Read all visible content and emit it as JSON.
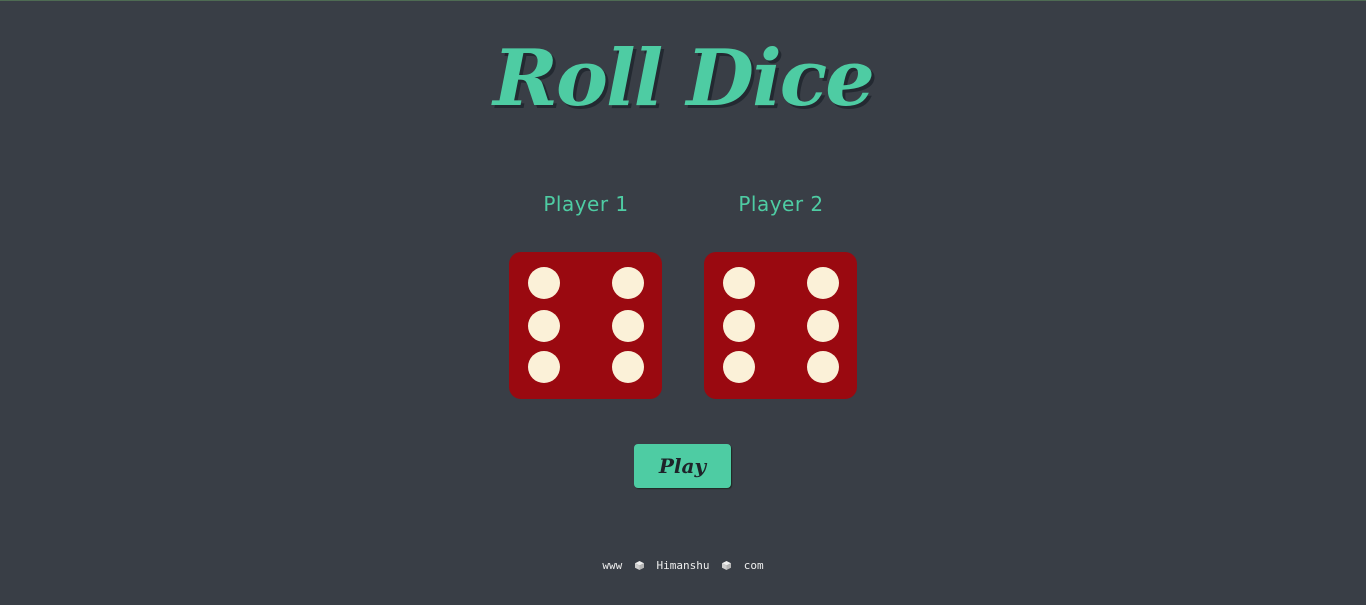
{
  "page": {
    "title": "Roll Dice"
  },
  "players": [
    {
      "label": "Player 1",
      "die_value": 6
    },
    {
      "label": "Player 2",
      "die_value": 6
    }
  ],
  "controls": {
    "play_label": "Play"
  },
  "footer": {
    "part1": "www",
    "part2": "Himanshu",
    "part3": "com",
    "separator_icon": "dice-icon"
  },
  "colors": {
    "background": "#393e46",
    "accent": "#4ecca3",
    "die_face": "#9a0910",
    "pip": "#fbf1d8"
  }
}
